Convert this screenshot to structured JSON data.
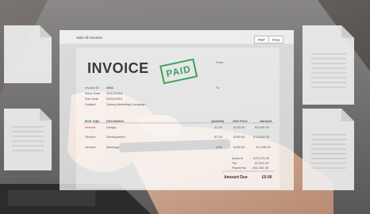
{
  "header": {
    "title": "Sale All Invoices",
    "buttons": [
      "PDF",
      "Print"
    ]
  },
  "invoice": {
    "title": "INVOICE",
    "stamp": "PAID",
    "from_label": "From",
    "to_label": "To",
    "meta": [
      {
        "label": "Invoice ID",
        "value": "#001"
      },
      {
        "label": "Issue Date",
        "value": "25/12/2018"
      },
      {
        "label": "Due Date",
        "value": "25/01/2019"
      },
      {
        "label": "Subject",
        "value": "Spring Marketing Campaign"
      }
    ],
    "table_headers": [
      "Item Type",
      "Description",
      "Quantity",
      "Unit Price",
      "Amount"
    ],
    "rows": [
      {
        "type": "Service",
        "description": "Design",
        "quantity": "41.00",
        "unit_price": "£230.00",
        "amount": "£9,430.00"
      },
      {
        "type": "Service",
        "description": "Development",
        "quantity": "57.00",
        "unit_price": "£330.00",
        "amount": "£18,810.00"
      },
      {
        "type": "Service",
        "description": "Meetings",
        "quantity": "4.50",
        "unit_price": "£230.00",
        "amount": "£1,035.00"
      }
    ],
    "totals": [
      {
        "label": "Amount",
        "value": "£29,275.00"
      },
      {
        "label": "Tax",
        "value": "£2,511.00"
      },
      {
        "label": "Payments",
        "value": "-£31,381.00"
      }
    ],
    "amount_due_label": "Amount Due",
    "amount_due_value": "£0.00"
  },
  "colors": {
    "stamp": "#3aa35a",
    "document_overlay": "#ffffff",
    "background": "#6f6a66"
  }
}
